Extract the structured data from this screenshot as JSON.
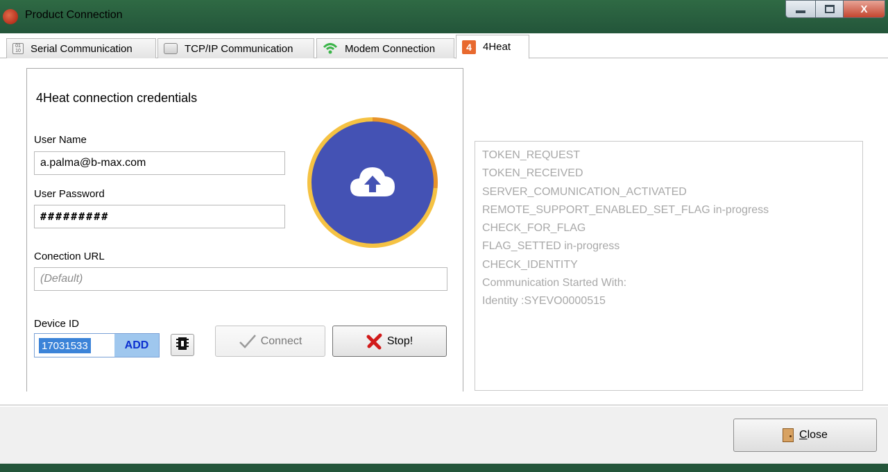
{
  "window": {
    "title": "Product Connection",
    "close_glyph": "X"
  },
  "tabs": [
    {
      "label": "Serial Communication",
      "icon": "serial-port-icon"
    },
    {
      "label": "TCP/IP Communication",
      "icon": "network-card-icon"
    },
    {
      "label": "Modem Connection",
      "icon": "wifi-icon"
    },
    {
      "label": "4Heat",
      "icon": "4heat-logo-icon",
      "active": true
    }
  ],
  "form": {
    "heading": "4Heat connection credentials",
    "username_label": "User Name",
    "username_value": "a.palma@b-max.com",
    "password_label": "User Password",
    "password_value": "#########",
    "url_label": "Conection URL",
    "url_placeholder": "(Default)",
    "device_label": "Device ID",
    "device_value": "17031533",
    "add_label": "ADD",
    "connect_label": "Connect",
    "stop_label": "Stop!"
  },
  "log": {
    "lines": [
      "TOKEN_REQUEST",
      "TOKEN_RECEIVED",
      "SERVER_COMUNICATION_ACTIVATED",
      "REMOTE_SUPPORT_ENABLED_SET_FLAG in-progress",
      "CHECK_FOR_FLAG",
      "FLAG_SETTED in-progress",
      "CHECK_IDENTITY",
      "Communication Started With:",
      "Identity :SYEVO0000515"
    ]
  },
  "footer": {
    "close_label_mnemonic": "C",
    "close_label_rest": "lose"
  },
  "colors": {
    "titlebar": "#2f6a44",
    "cloud_circle": "#4452b4",
    "progress_ring": "#f5c243",
    "progress_ring_active": "#e8932a",
    "log_text": "#a8a8a8",
    "add_text": "#0b2fd0"
  }
}
